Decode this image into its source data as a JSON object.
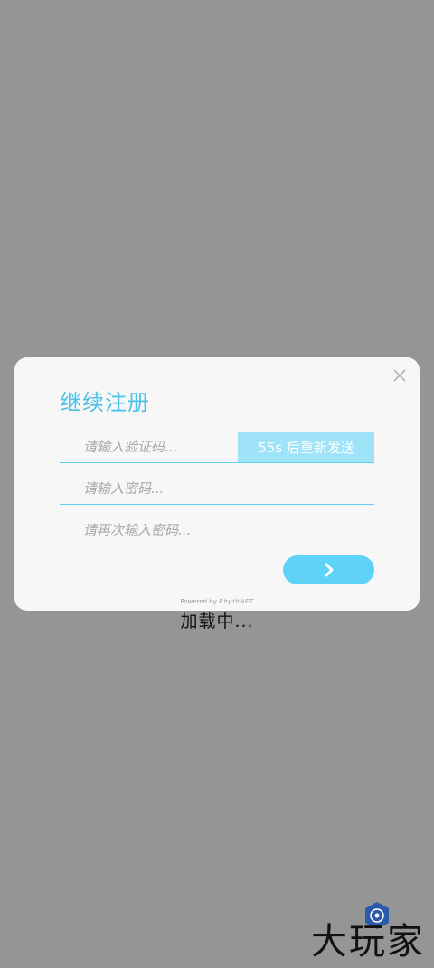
{
  "loading": {
    "text": "加载中..."
  },
  "dialog": {
    "title": "继续注册",
    "code_placeholder": "请输入验证码...",
    "resend_label": "55s 后重新发送",
    "password_placeholder": "请输入密码...",
    "confirm_password_placeholder": "请再次输入密码...",
    "submit_icon": "chevron-right-icon",
    "close_icon": "close-icon",
    "powered_by_prefix": "Powered by",
    "powered_by_brand": "RhythNET"
  },
  "watermark": {
    "text": "大玩家"
  },
  "colors": {
    "background": "#959595",
    "dialog": "#f7f7f7",
    "accent": "#4cc1e8",
    "resend_button": "#9fe3f8",
    "submit_button": "#5fd3f7"
  }
}
